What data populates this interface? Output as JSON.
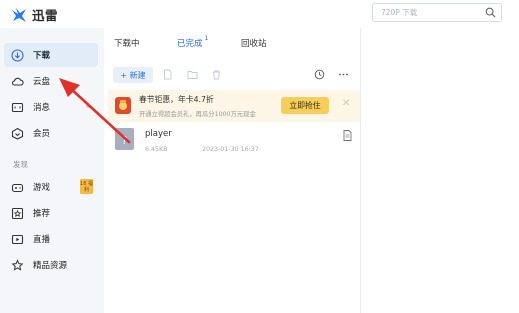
{
  "app": {
    "name": "迅雷"
  },
  "search": {
    "placeholder": "720P 下载"
  },
  "sidebar": {
    "items": [
      {
        "label": "下载",
        "icon": "download-circle-icon",
        "active": true
      },
      {
        "label": "云盘",
        "icon": "cloud-icon"
      },
      {
        "label": "消息",
        "icon": "message-icon"
      },
      {
        "label": "会员",
        "icon": "diamond-icon"
      }
    ],
    "section": "发现",
    "discover": [
      {
        "label": "游戏",
        "icon": "gamepad-icon",
        "badge": "18 福利"
      },
      {
        "label": "推荐",
        "icon": "star-box-icon"
      },
      {
        "label": "直播",
        "icon": "tv-icon"
      },
      {
        "label": "精品资源",
        "icon": "gem-icon"
      }
    ]
  },
  "tabs": [
    {
      "label": "下载中"
    },
    {
      "label": "已完成",
      "count": "1",
      "active": true
    },
    {
      "label": "回收站"
    }
  ],
  "toolbar": {
    "new_label": "+ 新建"
  },
  "promo": {
    "title": "春节钜惠，年卡4.7折",
    "subtitle": "开通立得超会员礼，再瓜分1000万元现金",
    "button": "立即抢住",
    "close": "✕"
  },
  "files": [
    {
      "name": "player",
      "size": "6.45KB",
      "date": "2023-01-30 16:37"
    }
  ],
  "colors": {
    "accent": "#2f6fd6",
    "arrow": "#e0312b",
    "promo_button": "#f6ce5b"
  }
}
